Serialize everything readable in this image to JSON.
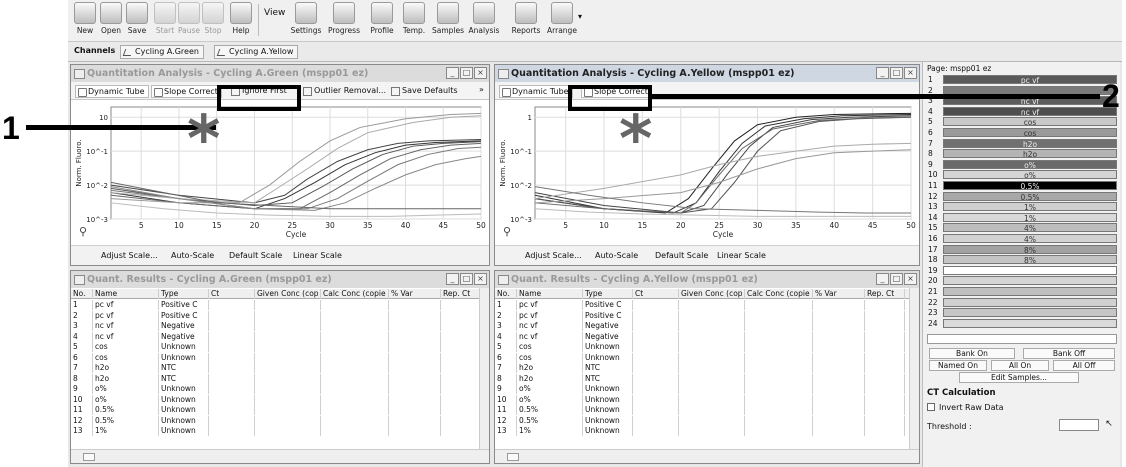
{
  "toolbar": {
    "items": [
      {
        "label": "New",
        "icon": "new-file-icon",
        "disabled": false
      },
      {
        "label": "Open",
        "icon": "open-folder-icon",
        "disabled": false
      },
      {
        "label": "Save",
        "icon": "save-disk-icon",
        "disabled": false
      },
      {
        "label": "Start",
        "icon": "play-icon",
        "disabled": true
      },
      {
        "label": "Pause",
        "icon": "pause-icon",
        "disabled": true
      },
      {
        "label": "Stop",
        "icon": "stop-icon",
        "disabled": true
      },
      {
        "label": "Help",
        "icon": "help-icon",
        "disabled": false
      }
    ],
    "view_label": "View",
    "view_items": [
      {
        "label": "Settings",
        "icon": "settings-icon"
      },
      {
        "label": "Progress",
        "icon": "progress-icon"
      },
      {
        "label": "Profile",
        "icon": "profile-icon"
      },
      {
        "label": "Temp.",
        "icon": "temperature-icon"
      },
      {
        "label": "Samples",
        "icon": "samples-icon"
      },
      {
        "label": "Analysis",
        "icon": "analysis-icon"
      },
      {
        "label": "Reports",
        "icon": "reports-icon"
      },
      {
        "label": "Arrange",
        "icon": "arrange-icon"
      }
    ]
  },
  "channels": {
    "label": "Channels",
    "items": [
      "Cycling A.Green",
      "Cycling A.Yellow"
    ]
  },
  "left_chart_pane": {
    "title": "Quantitation Analysis - Cycling A.Green (mspp01 ez)",
    "tools": [
      "Dynamic Tube",
      "Slope Correct",
      "Ignore First",
      "Outlier Removal...",
      "Save Defaults"
    ],
    "more": "»"
  },
  "right_chart_pane": {
    "title": "Quantitation Analysis - Cycling A.Yellow (mspp01 ez)",
    "tools": [
      "Dynamic Tube",
      "Slope Correct"
    ]
  },
  "bottom_bar": {
    "buttons": [
      "Adjust Scale...",
      "Auto-Scale",
      "Default Scale",
      "Linear Scale"
    ]
  },
  "chart_data": [
    {
      "type": "line",
      "xlabel": "Cycle",
      "ylabel": "Norm. Fluoro.",
      "yscale": "log",
      "x_ticks": [
        "5",
        "10",
        "15",
        "20",
        "25",
        "30",
        "35",
        "40",
        "45",
        "50"
      ],
      "y_ticks": [
        "10^-3",
        "10^-2",
        "10^-1",
        "10"
      ],
      "xlim": [
        1,
        50
      ],
      "ylim": [
        0.001,
        2
      ],
      "grid": true,
      "series": [
        {
          "color": "#333333",
          "x": [
            1,
            10,
            20,
            24,
            28,
            32,
            36,
            40,
            44,
            50
          ],
          "y": [
            0.006,
            0.003,
            0.002,
            0.004,
            0.012,
            0.04,
            0.09,
            0.15,
            0.18,
            0.2
          ]
        },
        {
          "color": "#555555",
          "x": [
            1,
            10,
            20,
            25,
            29,
            33,
            37,
            41,
            45,
            50
          ],
          "y": [
            0.008,
            0.004,
            0.0025,
            0.003,
            0.009,
            0.03,
            0.08,
            0.14,
            0.17,
            0.19
          ]
        },
        {
          "color": "#666666",
          "x": [
            1,
            10,
            20,
            26,
            30,
            34,
            38,
            42,
            46,
            50
          ],
          "y": [
            0.005,
            0.003,
            0.002,
            0.002,
            0.006,
            0.02,
            0.06,
            0.11,
            0.15,
            0.17
          ]
        },
        {
          "color": "#444444",
          "x": [
            1,
            10,
            20,
            24,
            27,
            31,
            35,
            39,
            43,
            50
          ],
          "y": [
            0.01,
            0.005,
            0.003,
            0.005,
            0.015,
            0.05,
            0.11,
            0.17,
            0.2,
            0.22
          ]
        },
        {
          "color": "#777777",
          "x": [
            1,
            10,
            20,
            27,
            31,
            35,
            39,
            43,
            47,
            50
          ],
          "y": [
            0.007,
            0.004,
            0.002,
            0.002,
            0.004,
            0.013,
            0.04,
            0.08,
            0.12,
            0.13
          ]
        },
        {
          "color": "#999999",
          "x": [
            1,
            10,
            18,
            22,
            26,
            30,
            34,
            40,
            46,
            50
          ],
          "y": [
            0.004,
            0.003,
            0.003,
            0.01,
            0.05,
            0.2,
            0.5,
            0.9,
            1.2,
            1.3
          ]
        },
        {
          "color": "#aaaaaa",
          "x": [
            1,
            10,
            20,
            23,
            27,
            31,
            35,
            41,
            46,
            50
          ],
          "y": [
            0.006,
            0.004,
            0.003,
            0.008,
            0.03,
            0.12,
            0.35,
            0.7,
            1,
            1.1
          ]
        },
        {
          "color": "#888888",
          "x": [
            1,
            10,
            20,
            28,
            32,
            36,
            40,
            44,
            48,
            50
          ],
          "y": [
            0.009,
            0.004,
            0.002,
            0.0018,
            0.003,
            0.008,
            0.02,
            0.04,
            0.06,
            0.07
          ]
        },
        {
          "color": "#bbbbbb",
          "x": [
            1,
            8,
            15,
            22,
            30,
            38,
            44,
            50
          ],
          "y": [
            0.003,
            0.002,
            0.0015,
            0.0013,
            0.0012,
            0.0012,
            0.0013,
            0.0014
          ]
        },
        {
          "color": "#666666",
          "x": [
            1,
            8,
            15,
            22,
            30,
            38,
            44,
            50
          ],
          "y": [
            0.012,
            0.006,
            0.003,
            0.0025,
            0.002,
            0.002,
            0.002,
            0.002
          ]
        }
      ]
    },
    {
      "type": "line",
      "xlabel": "Cycle",
      "ylabel": "Norm. Fluoro.",
      "yscale": "log",
      "x_ticks": [
        "5",
        "10",
        "15",
        "20",
        "25",
        "30",
        "35",
        "40",
        "45",
        "50"
      ],
      "y_ticks": [
        "10^-3",
        "10^-2",
        "10^-1",
        "1"
      ],
      "xlim": [
        1,
        50
      ],
      "ylim": [
        0.001,
        2
      ],
      "grid": true,
      "series": [
        {
          "color": "#222222",
          "x": [
            1,
            10,
            18,
            21,
            24,
            27,
            30,
            35,
            40,
            50
          ],
          "y": [
            0.004,
            0.002,
            0.0015,
            0.004,
            0.03,
            0.2,
            0.6,
            1,
            1.2,
            1.3
          ]
        },
        {
          "color": "#333333",
          "x": [
            1,
            10,
            19,
            22,
            25,
            28,
            31,
            36,
            41,
            50
          ],
          "y": [
            0.005,
            0.002,
            0.0015,
            0.003,
            0.025,
            0.17,
            0.55,
            0.9,
            1.1,
            1.2
          ]
        },
        {
          "color": "#444444",
          "x": [
            1,
            10,
            20,
            23,
            26,
            29,
            32,
            37,
            42,
            50
          ],
          "y": [
            0.006,
            0.0025,
            0.0015,
            0.0025,
            0.02,
            0.14,
            0.5,
            0.85,
            1,
            1.1
          ]
        },
        {
          "color": "#555555",
          "x": [
            1,
            10,
            20,
            24,
            27,
            30,
            33,
            38,
            43,
            50
          ],
          "y": [
            0.004,
            0.002,
            0.0015,
            0.002,
            0.012,
            0.1,
            0.4,
            0.75,
            0.9,
            1
          ]
        },
        {
          "color": "#666666",
          "x": [
            1,
            10,
            20,
            22,
            25,
            28,
            32,
            38,
            44,
            50
          ],
          "y": [
            0.003,
            0.002,
            0.0015,
            0.003,
            0.02,
            0.12,
            0.45,
            0.8,
            0.95,
            1
          ]
        },
        {
          "color": "#999999",
          "x": [
            1,
            10,
            20,
            25,
            30,
            35,
            40,
            45,
            50
          ],
          "y": [
            0.003,
            0.004,
            0.006,
            0.012,
            0.03,
            0.06,
            0.09,
            0.1,
            0.11
          ]
        },
        {
          "color": "#aaaaaa",
          "x": [
            1,
            10,
            20,
            25,
            30,
            35,
            40,
            45,
            50
          ],
          "y": [
            0.004,
            0.008,
            0.02,
            0.04,
            0.07,
            0.1,
            0.14,
            0.16,
            0.17
          ]
        },
        {
          "color": "#777777",
          "x": [
            1,
            8,
            15,
            22,
            30,
            38,
            44,
            50
          ],
          "y": [
            0.009,
            0.005,
            0.003,
            0.002,
            0.0018,
            0.0016,
            0.0015,
            0.0015
          ]
        },
        {
          "color": "#bbbbbb",
          "x": [
            1,
            8,
            15,
            22,
            30,
            38,
            44,
            50
          ],
          "y": [
            0.002,
            0.0016,
            0.0014,
            0.0013,
            0.0012,
            0.0012,
            0.0012,
            0.0012
          ]
        }
      ]
    }
  ],
  "left_table": {
    "title": "Quant. Results - Cycling A.Green (mspp01 ez)",
    "columns": [
      "No.",
      "Name",
      "Type",
      "Ct",
      "Given Conc (cop",
      "Calc Conc (copie",
      "% Var",
      "Rep. Ct"
    ],
    "rows": [
      [
        "1",
        "pc vf",
        "Positive C"
      ],
      [
        "2",
        "pc vf",
        "Positive C"
      ],
      [
        "3",
        "nc vf",
        "Negative"
      ],
      [
        "4",
        "nc vf",
        "Negative"
      ],
      [
        "5",
        "cos",
        "Unknown"
      ],
      [
        "6",
        "cos",
        "Unknown"
      ],
      [
        "7",
        "h2o",
        "NTC"
      ],
      [
        "8",
        "h2o",
        "NTC"
      ],
      [
        "9",
        "o%",
        "Unknown"
      ],
      [
        "10",
        "o%",
        "Unknown"
      ],
      [
        "11",
        "0.5%",
        "Unknown"
      ],
      [
        "12",
        "0.5%",
        "Unknown"
      ],
      [
        "13",
        "1%",
        "Unknown"
      ]
    ]
  },
  "right_table": {
    "title": "Quant. Results - Cycling A.Yellow (mspp01 ez)",
    "columns": [
      "No.",
      "Name",
      "Type",
      "Ct",
      "Given Conc (cop",
      "Calc Conc (copie",
      "% Var",
      "Rep. Ct"
    ],
    "rows": [
      [
        "1",
        "pc vf",
        "Positive C"
      ],
      [
        "2",
        "pc vf",
        "Positive C"
      ],
      [
        "3",
        "nc vf",
        "Negative"
      ],
      [
        "4",
        "nc vf",
        "Negative"
      ],
      [
        "5",
        "cos",
        "Unknown"
      ],
      [
        "6",
        "cos",
        "Unknown"
      ],
      [
        "7",
        "h2o",
        "NTC"
      ],
      [
        "8",
        "h2o",
        "NTC"
      ],
      [
        "9",
        "o%",
        "Unknown"
      ],
      [
        "10",
        "o%",
        "Unknown"
      ],
      [
        "11",
        "0.5%",
        "Unknown"
      ],
      [
        "12",
        "0.5%",
        "Unknown"
      ],
      [
        "13",
        "1%",
        "Unknown"
      ]
    ]
  },
  "sidebar": {
    "page_label": "Page: mspp01 ez",
    "samples": [
      {
        "n": "1",
        "name": "pc vf",
        "color": "#5a5a5a"
      },
      {
        "n": "2",
        "name": "",
        "color": "#7a7a7a"
      },
      {
        "n": "3",
        "name": "nc vf",
        "color": "#5d5d5d"
      },
      {
        "n": "4",
        "name": "nc vf",
        "color": "#4e4e4e"
      },
      {
        "n": "5",
        "name": "cos",
        "color": "#c8c8c8"
      },
      {
        "n": "6",
        "name": "cos",
        "color": "#9a9a9a"
      },
      {
        "n": "7",
        "name": "h2o",
        "color": "#707070"
      },
      {
        "n": "8",
        "name": "h2o",
        "color": "#b4b4b4"
      },
      {
        "n": "9",
        "name": "o%",
        "color": "#6a6a6a"
      },
      {
        "n": "10",
        "name": "o%",
        "color": "#d4d4d4"
      },
      {
        "n": "11",
        "name": "0.5%",
        "color": "#000000"
      },
      {
        "n": "12",
        "name": "0.5%",
        "color": "#a8a8a8"
      },
      {
        "n": "13",
        "name": "1%",
        "color": "#cfcfcf"
      },
      {
        "n": "14",
        "name": "1%",
        "color": "#d9d9d9"
      },
      {
        "n": "15",
        "name": "4%",
        "color": "#bdbdbd"
      },
      {
        "n": "16",
        "name": "4%",
        "color": "#d2d2d2"
      },
      {
        "n": "17",
        "name": "8%",
        "color": "#a2a2a2"
      },
      {
        "n": "18",
        "name": "8%",
        "color": "#c4c4c4"
      },
      {
        "n": "19",
        "name": "",
        "color": "#ffffff"
      },
      {
        "n": "20",
        "name": "",
        "color": "#d5d5d5"
      },
      {
        "n": "21",
        "name": "",
        "color": "#bfbfbf"
      },
      {
        "n": "22",
        "name": "",
        "color": "#d0d0d0"
      },
      {
        "n": "23",
        "name": "",
        "color": "#c6c6c6"
      },
      {
        "n": "24",
        "name": "",
        "color": "#dadada"
      }
    ],
    "buttons_row1": [
      "Bank On",
      "Bank Off"
    ],
    "buttons_row2": [
      "Named On",
      "All On",
      "All Off"
    ],
    "edit_samples": "Edit Samples...",
    "ct_title": "CT Calculation",
    "invert_label": "Invert Raw Data",
    "threshold_label": "Threshold :"
  },
  "callouts": [
    {
      "label": "1"
    },
    {
      "label": "2"
    }
  ],
  "asterisk": "*"
}
